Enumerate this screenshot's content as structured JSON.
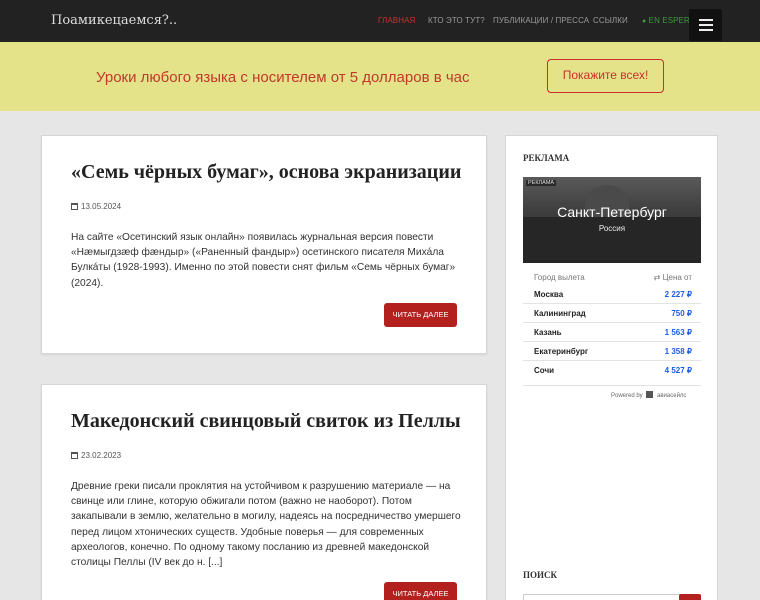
{
  "site": {
    "brand": "Поамикецаемся?..",
    "nav": [
      "ГЛАВНАЯ",
      "КТО ЭТО ТУТ?",
      "ПУБЛИКАЦИИ / ПРЕССА",
      "ССЫЛКИ",
      "EN ESPERA"
    ]
  },
  "banner": {
    "text": "Уроки любого языка с носителем от 5 долларов в час",
    "button": "Покажите всех!"
  },
  "posts": [
    {
      "title": "«Семь чёрных бумаг», основа экранизации",
      "date": "13.05.2024",
      "body": "На сайте «Осетинский язык онлайн» появилась журнальная версия повести «Нæмыгдзæф фæндыр» («Раненный фандыр») осетинского писателя Михáла Булкáты (1928-1993). Именно по этой повести снят фильм «Семь чёрных бумаг» (2024).",
      "more": "ЧИТАТЬ ДАЛЕЕ"
    },
    {
      "title": "Македонский свинцовый свиток из Пеллы",
      "date": "23.02.2023",
      "body": "Древние греки писали проклятия на устойчивом к разрушению материале — на свинце или глине, которую обжигали потом (важно не наоборот). Потом закапывали в землю, желательно в могилу, надеясь на посредничество умершего перед лицом хтонических существ. Удобные поверья — для современных археологов, конечно. По одному такому посланию из древней македонской столицы Пеллы (IV век до н. [...]",
      "more": "ЧИТАТЬ ДАЛЕЕ"
    }
  ],
  "sidebar": {
    "ad_title": "РЕКЛАМА",
    "ad": {
      "badge": "РЕКЛАМА",
      "city": "Санкт-Петербург",
      "country": "Россия",
      "col_from": "Город вылета",
      "col_price": "⇄ Цена от",
      "rows": [
        {
          "city": "Москва",
          "price": "2 227 ₽"
        },
        {
          "city": "Калининград",
          "price": "750 ₽"
        },
        {
          "city": "Казань",
          "price": "1 563 ₽"
        },
        {
          "city": "Екатеринбург",
          "price": "1 358 ₽"
        },
        {
          "city": "Сочи",
          "price": "4 527 ₽"
        }
      ],
      "powered_label": "Powered by",
      "powered_brand": "авиасейлс"
    },
    "search_title": "ПОИСК"
  }
}
